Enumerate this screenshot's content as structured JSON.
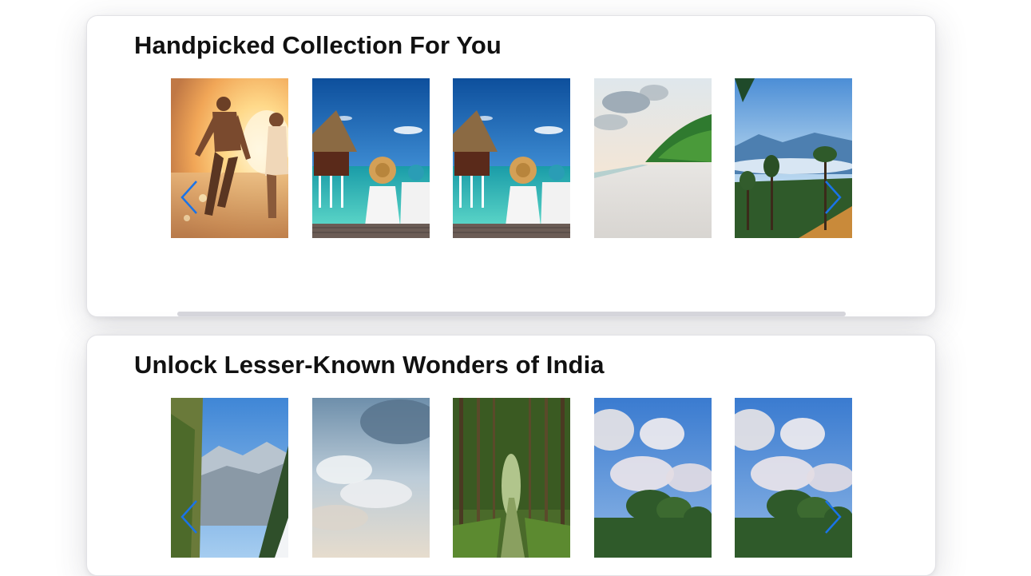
{
  "sections": [
    {
      "title": "Handpicked Collection For You",
      "tiles": [
        {
          "icon": "couple-running-beach-photo"
        },
        {
          "icon": "couple-overwater-villa-photo"
        },
        {
          "icon": "couple-overwater-villa-photo"
        },
        {
          "icon": "tropical-beach-photo"
        },
        {
          "icon": "mountain-forest-photo"
        }
      ],
      "prev_icon": "chevron-left-icon",
      "next_icon": "chevron-right-icon"
    },
    {
      "title": "Unlock Lesser-Known Wonders of India",
      "tiles": [
        {
          "icon": "mountain-valley-photo"
        },
        {
          "icon": "cloudy-sky-photo"
        },
        {
          "icon": "forest-road-photo"
        },
        {
          "icon": "cloud-trees-photo"
        },
        {
          "icon": "cloud-trees-photo"
        }
      ],
      "prev_icon": "chevron-left-icon",
      "next_icon": "chevron-right-icon"
    }
  ],
  "colors": {
    "arrow": "#1a73e8",
    "title": "#111111",
    "card_border": "#e2e2e6"
  }
}
